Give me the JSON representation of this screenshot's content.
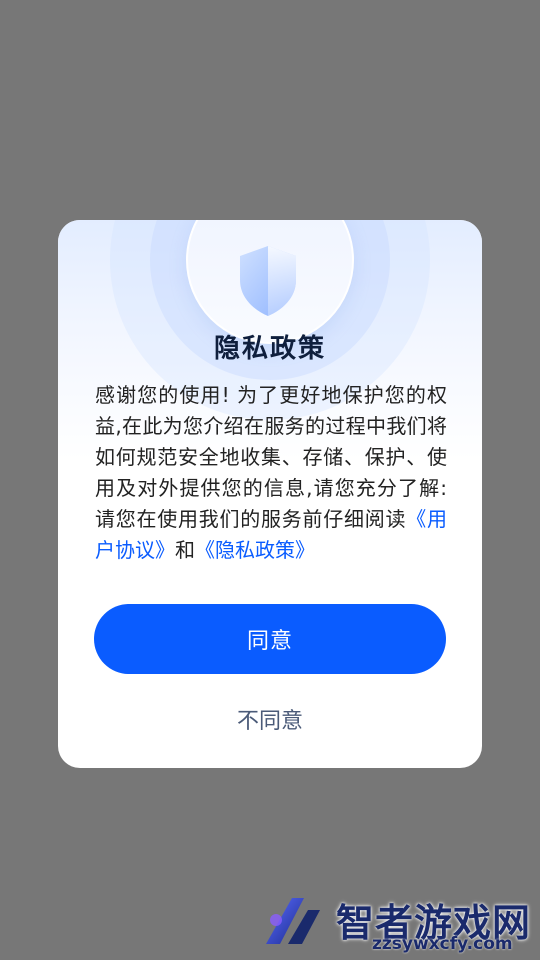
{
  "dialog": {
    "title": "隐私政策",
    "body_prefix": "感谢您的使用! 为了更好地保护您的权益,在此为您介绍在服务的过程中我们将如何规范安全地收集、存储、保护、使用及对外提供您的信息,请您充分了解:请您在使用我们的服务前仔细阅读",
    "user_agreement_link": "《用户协议》",
    "conjunction": "和",
    "privacy_policy_link": "《隐私政策》",
    "agree_label": "同意",
    "disagree_label": "不同意"
  },
  "watermark": {
    "name": "智者游戏网",
    "url": "zzsywxcfy.com"
  },
  "icons": {
    "dialog_header": "shield-icon",
    "watermark_logo": "brand-logo-icon"
  },
  "colors": {
    "accent": "#0a5cff",
    "overlay": "#777777",
    "title": "#0f1f3d"
  }
}
